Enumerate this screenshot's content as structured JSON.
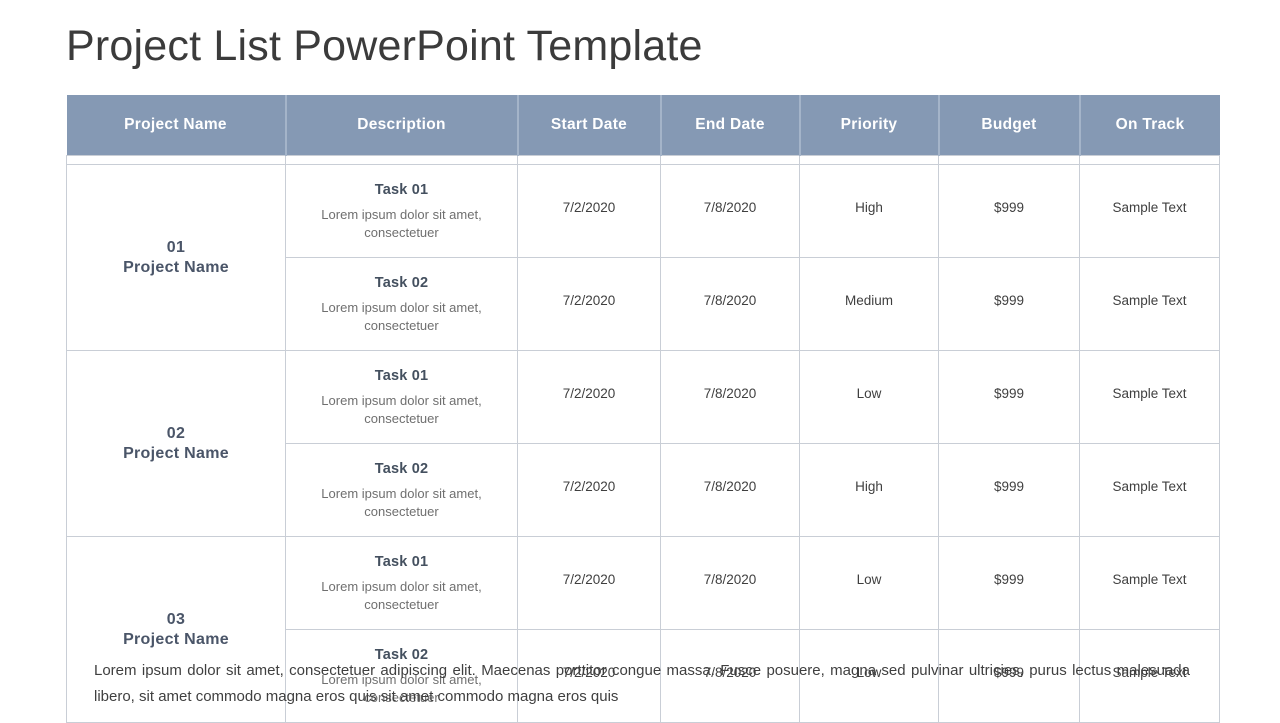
{
  "title": "Project List PowerPoint Template",
  "table": {
    "headers": [
      "Project Name",
      "Description",
      "Start Date",
      "End Date",
      "Priority",
      "Budget",
      "On Track"
    ],
    "projects": [
      {
        "number": "01",
        "name": "Project Name"
      },
      {
        "number": "02",
        "name": "Project Name"
      },
      {
        "number": "03",
        "name": "Project Name"
      }
    ],
    "rows": [
      {
        "task_title": "Task 01",
        "task_body": "Lorem ipsum dolor sit amet, consectetuer",
        "start_date": "7/2/2020",
        "end_date": "7/8/2020",
        "priority": "High",
        "budget": "$999",
        "on_track": "Sample Text"
      },
      {
        "task_title": "Task 02",
        "task_body": "Lorem ipsum dolor sit amet, consectetuer",
        "start_date": "7/2/2020",
        "end_date": "7/8/2020",
        "priority": "Medium",
        "budget": "$999",
        "on_track": "Sample Text"
      },
      {
        "task_title": "Task 01",
        "task_body": "Lorem ipsum dolor sit amet, consectetuer",
        "start_date": "7/2/2020",
        "end_date": "7/8/2020",
        "priority": "Low",
        "budget": "$999",
        "on_track": "Sample Text"
      },
      {
        "task_title": "Task 02",
        "task_body": "Lorem ipsum dolor sit amet, consectetuer",
        "start_date": "7/2/2020",
        "end_date": "7/8/2020",
        "priority": "High",
        "budget": "$999",
        "on_track": "Sample Text"
      },
      {
        "task_title": "Task 01",
        "task_body": "Lorem ipsum dolor sit amet, consectetuer",
        "start_date": "7/2/2020",
        "end_date": "7/8/2020",
        "priority": "Low",
        "budget": "$999",
        "on_track": "Sample Text"
      },
      {
        "task_title": "Task 02",
        "task_body": "Lorem ipsum dolor sit amet, consectetuer",
        "start_date": "7/2/2020",
        "end_date": "7/8/2020",
        "priority": "Low",
        "budget": "$999",
        "on_track": "Sample Text"
      }
    ]
  },
  "footer": {
    "text": "Lorem ipsum dolor sit amet, consectetuer adipiscing elit. Maecenas porttitor congue massa. Fusce posuere, magna sed pulvinar ultricies, purus lectus malesuada libero, sit amet commodo magna eros quis sit amet commodo magna eros quis"
  },
  "colors": {
    "header_background": "#8599b4",
    "header_text": "#ffffff",
    "header_divider": "#a4b4c9",
    "grid_line": "#c9ced6",
    "title_text": "#3b3b3b",
    "project_text": "#4a5568",
    "task_title_text": "#44505f",
    "task_body_text": "#6f6f6f",
    "data_text": "#3f3f3f"
  }
}
